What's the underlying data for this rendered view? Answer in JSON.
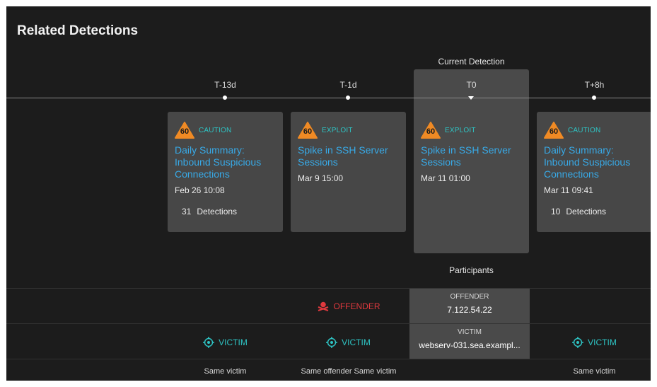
{
  "title": "Related Detections",
  "current_label": "Current Detection",
  "participants_label": "Participants",
  "colors": {
    "risk": "#f08a24",
    "category": "#2ec4c4",
    "link": "#38a9e6",
    "offender": "#e0393e",
    "victim": "#2ec4c4"
  },
  "ticks": [
    "T-13d",
    "T-1d",
    "T0",
    "T+8h"
  ],
  "cards": [
    {
      "risk": "60",
      "category": "CAUTION",
      "title": "Daily Summary: Inbound Suspicious Connections",
      "time": "Feb 26 10:08",
      "count": "31",
      "count_label": "Detections"
    },
    {
      "risk": "60",
      "category": "EXPLOIT",
      "title": "Spike in SSH Server Sessions",
      "time": "Mar 9 15:00",
      "count": "",
      "count_label": ""
    },
    {
      "risk": "60",
      "category": "EXPLOIT",
      "title": "Spike in SSH Server Sessions",
      "time": "Mar 11 01:00",
      "count": "",
      "count_label": ""
    },
    {
      "risk": "60",
      "category": "CAUTION",
      "title": "Daily Summary: Inbound Suspicious Connections",
      "time": "Mar 11 09:41",
      "count": "10",
      "count_label": "Detections"
    }
  ],
  "current_participants": {
    "offender_label": "OFFENDER",
    "offender_value": "7.122.54.22",
    "victim_label": "VICTIM",
    "victim_value": "webserv-031.sea.exampl..."
  },
  "roles": {
    "offender": "OFFENDER",
    "victim": "VICTIM"
  },
  "same_notes": [
    "Same victim",
    "Same offender Same victim",
    "Same victim"
  ]
}
